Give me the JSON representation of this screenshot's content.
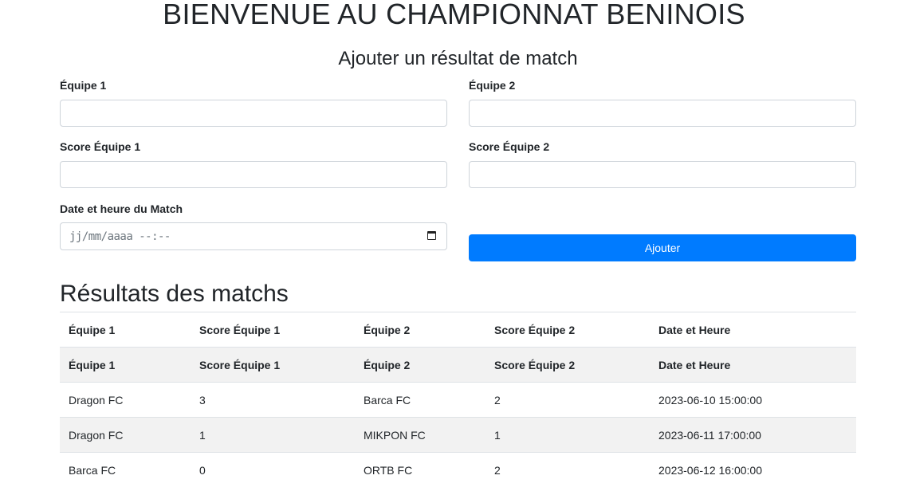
{
  "header": {
    "title": "BIENVENUE AU CHAMPIONNAT BENINOIS"
  },
  "form": {
    "title": "Ajouter un résultat de match",
    "team1_label": "Équipe 1",
    "team1_value": "",
    "team2_label": "Équipe 2",
    "team2_value": "",
    "score1_label": "Score Équipe 1",
    "score1_value": "",
    "score2_label": "Score Équipe 2",
    "score2_value": "",
    "datetime_label": "Date et heure du Match",
    "datetime_placeholder": "jj/mm/aaaa --:--",
    "submit_label": "Ajouter"
  },
  "results": {
    "title": "Résultats des matchs",
    "columns": [
      "Équipe 1",
      "Score Équipe 1",
      "Équipe 2",
      "Score Équipe 2",
      "Date et Heure"
    ],
    "rows": [
      [
        "Équipe 1",
        "Score Équipe 1",
        "Équipe 2",
        "Score Équipe 2",
        "Date et Heure"
      ],
      [
        "Dragon FC",
        "3",
        "Barca FC",
        "2",
        "2023-06-10 15:00:00"
      ],
      [
        "Dragon FC",
        "1",
        "MIKPON FC",
        "1",
        "2023-06-11 17:00:00"
      ],
      [
        "Barca FC",
        "0",
        "ORTB FC",
        "2",
        "2023-06-12 16:00:00"
      ]
    ]
  },
  "colors": {
    "primary": "#007bff",
    "stripe": "#f2f2f2",
    "border": "#dee2e6"
  }
}
